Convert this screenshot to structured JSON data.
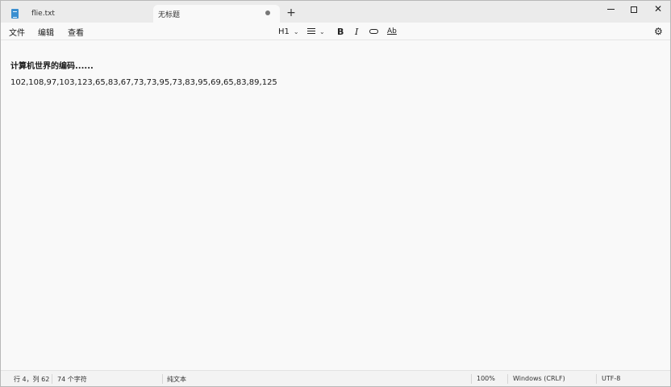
{
  "tabs": [
    {
      "label": "flie.txt",
      "icon": "notepad-icon",
      "active": false
    },
    {
      "label": "无标题",
      "icon": "none",
      "active": true,
      "unsaved": true
    }
  ],
  "new_tab_label": "+",
  "window_controls": {
    "minimize": "minimize-icon",
    "maximize": "maximize-icon",
    "close": "✕"
  },
  "menu": {
    "file": "文件",
    "edit": "编辑",
    "view": "查看"
  },
  "toolbar": {
    "heading_label": "H1",
    "bold_label": "B",
    "italic_label": "I",
    "spell_label": "Ab"
  },
  "editor": {
    "lines": [
      "计算机世界的编码......",
      "102,108,97,103,123,65,83,67,73,73,95,73,83,95,69,65,83,89,125"
    ]
  },
  "status": {
    "position": "行 4，列 62",
    "char_count": "74 个字符",
    "format": "纯文本",
    "zoom": "100%",
    "line_ending": "Windows (CRLF)",
    "encoding": "UTF-8"
  },
  "colors": {
    "accent": "#3b8fd0",
    "background": "#f9f9f9",
    "tabbar": "#ebebeb"
  }
}
